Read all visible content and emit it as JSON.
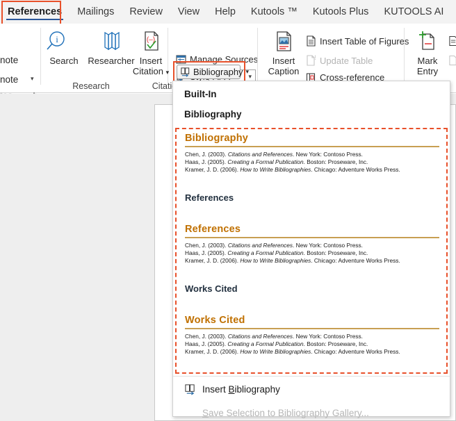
{
  "ribbon": {
    "tabs": [
      {
        "label": "References",
        "active": true
      },
      {
        "label": "Mailings",
        "active": false
      },
      {
        "label": "Review",
        "active": false
      },
      {
        "label": "View",
        "active": false
      },
      {
        "label": "Help",
        "active": false
      },
      {
        "label": "Kutools ™",
        "active": false
      },
      {
        "label": "Kutools Plus",
        "active": false
      },
      {
        "label": "KUTOOLS AI",
        "active": false
      }
    ],
    "groups": {
      "footnotes": {
        "label_clipped": "tes",
        "item1_clipped": "note",
        "item2_clipped": "note",
        "launcher_icon": "dialog-launcher-icon"
      },
      "research": {
        "label": "Research",
        "search_label": "Search",
        "researcher_label": "Researcher"
      },
      "citations": {
        "label_clipped": "Citatio",
        "insert_citation_label_line1": "Insert",
        "insert_citation_label_line2": "Citation",
        "manage_sources_label": "Manage Sources",
        "style_label": "Style:",
        "style_value": "APA",
        "bibliography_label": "Bibliography"
      },
      "captions": {
        "insert_caption_line1": "Insert",
        "insert_caption_line2": "Caption",
        "insert_table_of_figures_label": "Insert Table of Figures",
        "update_table_label": "Update Table",
        "cross_reference_label": "Cross-reference"
      },
      "index": {
        "mark_entry_line1": "Mark",
        "mark_entry_line2": "Entry"
      }
    }
  },
  "dropdown": {
    "section_built_in": "Built-In",
    "section_bibliography": "Bibliography",
    "gallery": [
      {
        "heading": "Bibliography",
        "style": "fancy",
        "refs": [
          {
            "author": "Chen, J. (2003). ",
            "title": "Citations and References",
            "rest": ". New York: Contoso Press."
          },
          {
            "author": "Haas, J. (2005). ",
            "title": "Creating a Formal Publication",
            "rest": ". Boston: Proseware, Inc."
          },
          {
            "author": "Kramer, J. D. (2006). ",
            "title": "How to Write Bibliographies",
            "rest": ". Chicago: Adventure Works Press."
          }
        ]
      },
      {
        "heading": "References",
        "style": "plain",
        "refs": []
      },
      {
        "heading": "References",
        "style": "fancy",
        "refs": [
          {
            "author": "Chen, J. (2003). ",
            "title": "Citations and References",
            "rest": ". New York: Contoso Press."
          },
          {
            "author": "Haas, J. (2005). ",
            "title": "Creating a Formal Publication",
            "rest": ". Boston: Proseware, Inc."
          },
          {
            "author": "Kramer, J. D. (2006). ",
            "title": "How to Write Bibliographies",
            "rest": ". Chicago: Adventure Works Press."
          }
        ]
      },
      {
        "heading": "Works Cited",
        "style": "plain",
        "refs": []
      },
      {
        "heading": "Works Cited",
        "style": "fancy",
        "refs": [
          {
            "author": "Chen, J. (2003). ",
            "title": "Citations and References",
            "rest": ". New York: Contoso Press."
          },
          {
            "author": "Haas, J. (2005). ",
            "title": "Creating a Formal Publication",
            "rest": ". Boston: Proseware, Inc."
          },
          {
            "author": "Kramer, J. D. (2006). ",
            "title": "How to Write Bibliographies",
            "rest": ". Chicago: Adventure Works Press."
          }
        ]
      }
    ],
    "insert_bibliography_label": "Insert Bibliography",
    "insert_bibliography_accel": "B",
    "save_selection_label": "ave Selection to Bibliography Gallery...",
    "save_selection_accel": "S"
  },
  "colors": {
    "accent_highlight": "#e8502a",
    "tab_underline": "#2b579a",
    "heading_gold": "#c07000",
    "rule_gold": "#c89f52",
    "heading_dark": "#22303f"
  }
}
